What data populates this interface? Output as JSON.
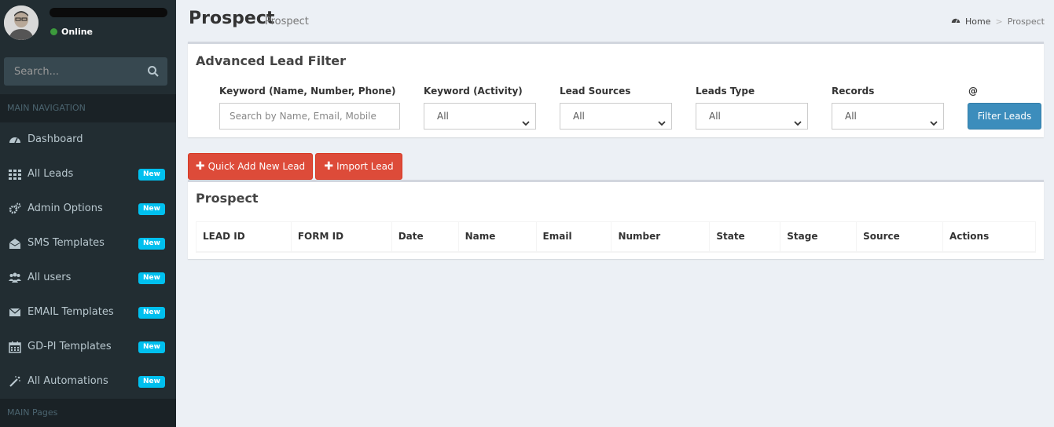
{
  "sidebar": {
    "user": {
      "status": "Online"
    },
    "search": {
      "placeholder": "Search..."
    },
    "headers": {
      "main_navigation": "MAIN NAVIGATION",
      "main_pages": "MAIN Pages"
    },
    "items": [
      {
        "label": "Dashboard",
        "icon": "dashboard-icon"
      },
      {
        "label": "All Leads",
        "icon": "grid-icon",
        "badge": "New"
      },
      {
        "label": "Admin Options",
        "icon": "cogs-icon",
        "badge": "New"
      },
      {
        "label": "SMS Templates",
        "icon": "envelope-open-icon",
        "badge": "New"
      },
      {
        "label": "All users",
        "icon": "users-icon",
        "badge": "New"
      },
      {
        "label": "EMAIL Templates",
        "icon": "envelope-icon",
        "badge": "New"
      },
      {
        "label": "GD-PI Templates",
        "icon": "calendar-icon",
        "badge": "New"
      },
      {
        "label": "All Automations",
        "icon": "magic-wand-icon",
        "badge": "New"
      }
    ]
  },
  "header": {
    "title": "Prospect",
    "subtitle": "Prospect",
    "breadcrumb": {
      "home": "Home",
      "separator": ">",
      "current": "Prospect"
    }
  },
  "filter": {
    "title": "Advanced Lead Filter",
    "keyword_label": "Keyword (Name, Number, Phone)",
    "keyword_placeholder": "Search by Name, Email, Mobile",
    "activity_label": "Keyword (Activity)",
    "activity_value": "All",
    "sources_label": "Lead Sources",
    "sources_value": "All",
    "type_label": "Leads Type",
    "type_value": "All",
    "records_label": "Records",
    "records_value": "All",
    "at_label": "@",
    "button": "Filter Leads"
  },
  "actions": {
    "quick_add": "Quick Add New Lead",
    "import": "Import Lead"
  },
  "table": {
    "title": "Prospect",
    "columns": [
      "LEAD ID",
      "FORM ID",
      "Date",
      "Name",
      "Email",
      "Number",
      "State",
      "Stage",
      "Source",
      "Actions"
    ]
  },
  "colors": {
    "sidebar_bg": "#222d32",
    "primary": "#3c8dbc",
    "danger": "#dd4b39",
    "badge": "#00c0ef",
    "online": "#3c9a3c"
  }
}
